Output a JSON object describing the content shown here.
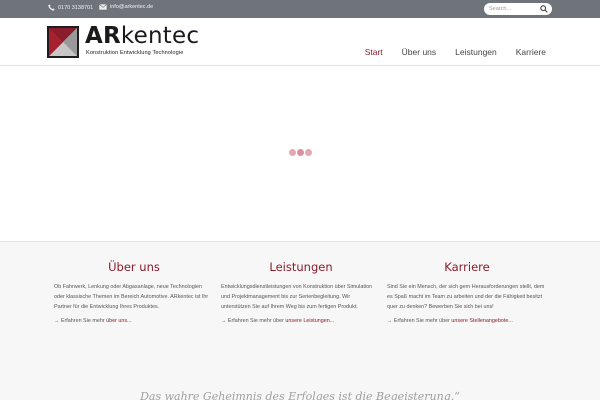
{
  "topbar": {
    "phone": "0170 3138701",
    "email": "info@arkentec.de",
    "search_placeholder": "Search..."
  },
  "logo": {
    "brand_bold": "AR",
    "brand_light": "kentec",
    "tagline": "Konstruktion  Entwicklung  Technologie"
  },
  "nav": {
    "items": [
      {
        "label": "Start",
        "active": true
      },
      {
        "label": "Über uns"
      },
      {
        "label": "Leistungen"
      },
      {
        "label": "Karriere"
      }
    ]
  },
  "colors": {
    "accent": "#8a1c2b",
    "topbar": "#6f747b"
  },
  "features": [
    {
      "title": "Über uns",
      "text": "Ob Fahrwerk, Lenkung oder Abgasanlage, neue Technologien oder klassische Themen im Bereich Automotive. ARkentec ist Ihr Partner für die Entwicklung Ihres Produktes.",
      "more_prefix": "→ Erfahren Sie mehr ",
      "more_link": "über uns..."
    },
    {
      "title": "Leistungen",
      "text": "Entwicklungsdienstleistungen von Konstruktion über Simulation und Projektmanagement bis zur Serienbegleitung. Wir unterstützen Sie auf Ihrem Weg bis zum fertigen Produkt.",
      "more_prefix": "→ Erfahren Sie mehr über ",
      "more_link": "unsere Leistungen..."
    },
    {
      "title": "Karriere",
      "text": "Sind Sie ein Mensch, der sich gern Herausforderungen stellt, dem es Spaß macht im Team zu arbeiten und der die Fähigkeit besitzt quer zu denken? Bewerben Sie sich bei uns!",
      "more_prefix": "→ Erfahren Sie mehr über ",
      "more_link": "unsere Stellenangebote..."
    }
  ],
  "quote": "Das wahre Geheimnis des Erfolges ist die Begeisterung.“"
}
